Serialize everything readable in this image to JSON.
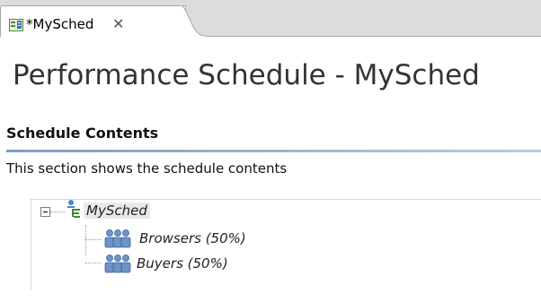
{
  "editor_tab": {
    "label": "*MySched",
    "icon": "schedule-editor-icon",
    "close_icon": "close-icon"
  },
  "page": {
    "title": "Performance Schedule - MySched"
  },
  "section": {
    "title": "Schedule Contents",
    "description": "This section shows the schedule contents"
  },
  "tree": {
    "root": {
      "label": "MySched",
      "icon": "schedule-icon",
      "expanded": true
    },
    "children": [
      {
        "label": "Browsers (50%)",
        "icon": "user-group-icon"
      },
      {
        "label": "Buyers (50%)",
        "icon": "user-group-icon"
      }
    ]
  },
  "colors": {
    "tabbar_bg": "#dcdcdc",
    "section_rule": "#7d9ec3",
    "title_text": "#333333",
    "selection_bg": "#e9e9e9"
  }
}
